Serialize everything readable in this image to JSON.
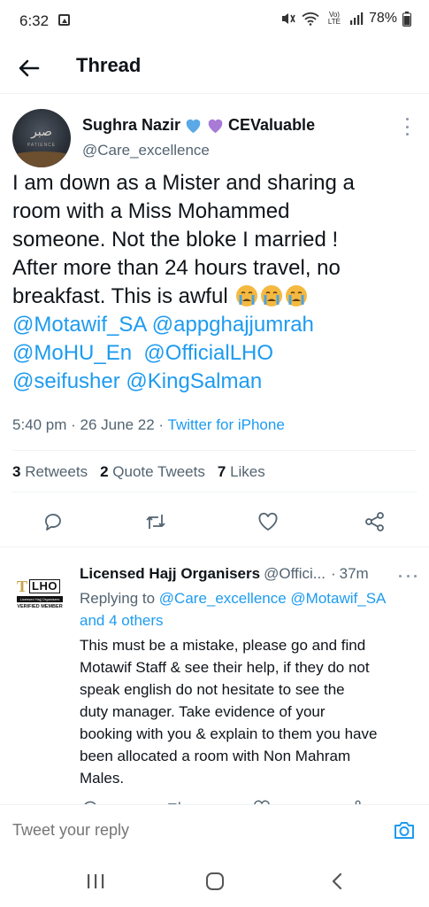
{
  "status_bar": {
    "time": "6:32",
    "battery": "78%",
    "lte": "Vo) LTE"
  },
  "header": {
    "title": "Thread"
  },
  "main_tweet": {
    "display_name": "Sughra Nazir",
    "name_suffix": "CEValuable",
    "handle": "@Care_excellence",
    "avatar_text": "صبر",
    "avatar_sub": "PATIENCE",
    "text_lines": [
      "I am down as a Mister and sharing a",
      "room with a Miss Mohammed",
      "someone. Not the bloke I married !",
      "After more than 24 hours travel, no",
      "breakfast. This is awful"
    ],
    "mentions_lines": [
      [
        "@Motawif_SA",
        "@appghajjumrah"
      ],
      [
        "@MoHU_En",
        "@OfficialLHO"
      ],
      [
        "@seifusher",
        "@KingSalman"
      ]
    ],
    "time": "5:40 pm",
    "date": "26 June 22",
    "source": "Twitter for iPhone",
    "stats": {
      "retweets_count": "3",
      "retweets_label": "Retweets",
      "quotes_count": "2",
      "quotes_label": "Quote Tweets",
      "likes_count": "7",
      "likes_label": "Likes"
    },
    "actions": [
      "reply-icon",
      "retweet-icon",
      "like-icon",
      "share-icon"
    ]
  },
  "reply": {
    "name": "Licensed Hajj Organisers",
    "handle": "@Offici...",
    "time": "37m",
    "avatar": {
      "logo_letters": "LHO",
      "bar_text": "Licensed Hajj Organisers",
      "verified": "VERIFIED MEMBER"
    },
    "replying_to_label": "Replying to",
    "replying_to": [
      "@Care_excellence",
      "@Motawif_SA"
    ],
    "replying_to_more": "and 4 others",
    "text_lines": [
      "This must be a mistake, please go and find",
      "Motawif Staff & see their help, if they do not",
      "speak english do not hesitate to see the",
      "duty manager. Take evidence of your",
      "booking with you & explain to them you have",
      "been allocated a room with Non Mahram",
      "Males."
    ]
  },
  "compose": {
    "placeholder": "Tweet your reply"
  },
  "colors": {
    "accent": "#1d9bf0",
    "text": "#0f1419",
    "secondary": "#536471",
    "heart_blue": "#5aa9e6",
    "heart_purple": "#a77bd6"
  }
}
